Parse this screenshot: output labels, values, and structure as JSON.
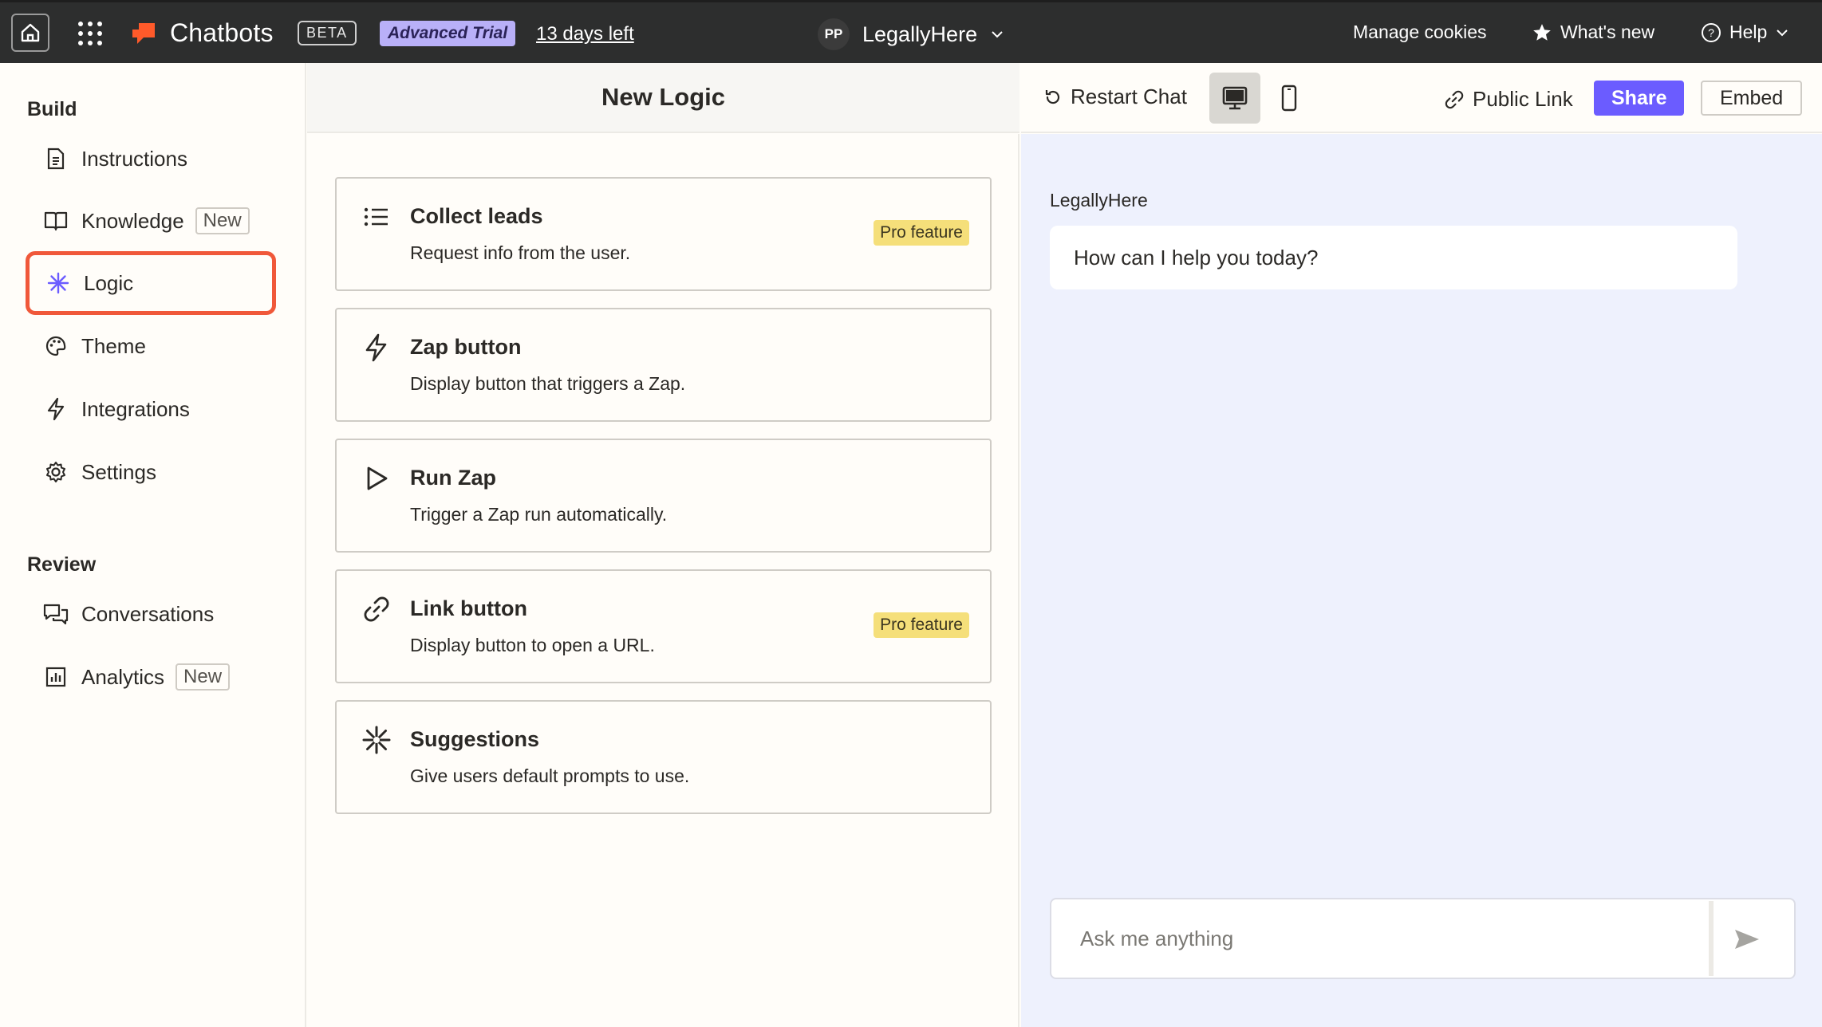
{
  "topbar": {
    "brand": "Chatbots",
    "beta": "BETA",
    "trial": "Advanced Trial",
    "days_left": "13 days left",
    "account_initials": "PP",
    "account_name": "LegallyHere",
    "manage_cookies": "Manage cookies",
    "whats_new": "What's new",
    "help": "Help"
  },
  "sidebar": {
    "build_heading": "Build",
    "review_heading": "Review",
    "build_items": [
      {
        "label": "Instructions",
        "icon": "document-icon"
      },
      {
        "label": "Knowledge",
        "icon": "book-icon",
        "badge": "New"
      },
      {
        "label": "Logic",
        "icon": "asterisk-icon",
        "active": true
      },
      {
        "label": "Theme",
        "icon": "palette-icon"
      },
      {
        "label": "Integrations",
        "icon": "lightning-icon"
      },
      {
        "label": "Settings",
        "icon": "gear-icon"
      }
    ],
    "review_items": [
      {
        "label": "Conversations",
        "icon": "chat-bubbles-icon"
      },
      {
        "label": "Analytics",
        "icon": "bar-chart-icon",
        "badge": "New"
      }
    ]
  },
  "middle": {
    "title": "New Logic",
    "cards": [
      {
        "title": "Collect leads",
        "desc": "Request info from the user.",
        "badge": "Pro feature",
        "icon": "list-icon"
      },
      {
        "title": "Zap button",
        "desc": "Display button that triggers a Zap.",
        "icon": "lightning-icon"
      },
      {
        "title": "Run Zap",
        "desc": "Trigger a Zap run automatically.",
        "icon": "play-icon"
      },
      {
        "title": "Link button",
        "desc": "Display button to open a URL.",
        "badge": "Pro feature",
        "icon": "link-icon"
      },
      {
        "title": "Suggestions",
        "desc": "Give users default prompts to use.",
        "icon": "sparkle-icon"
      }
    ]
  },
  "preview": {
    "restart": "Restart Chat",
    "public_link": "Public Link",
    "share": "Share",
    "embed": "Embed",
    "bot_name": "LegallyHere",
    "greeting": "How can I help you today?",
    "input_placeholder": "Ask me anything"
  },
  "colors": {
    "topbar": "#2d2e2e",
    "accent_share": "#6b5cff",
    "active_outline": "#f0583a",
    "pro_badge": "#f5df7a",
    "trial_badge": "#b9b0f8",
    "preview_bg": "#eef1fd"
  }
}
